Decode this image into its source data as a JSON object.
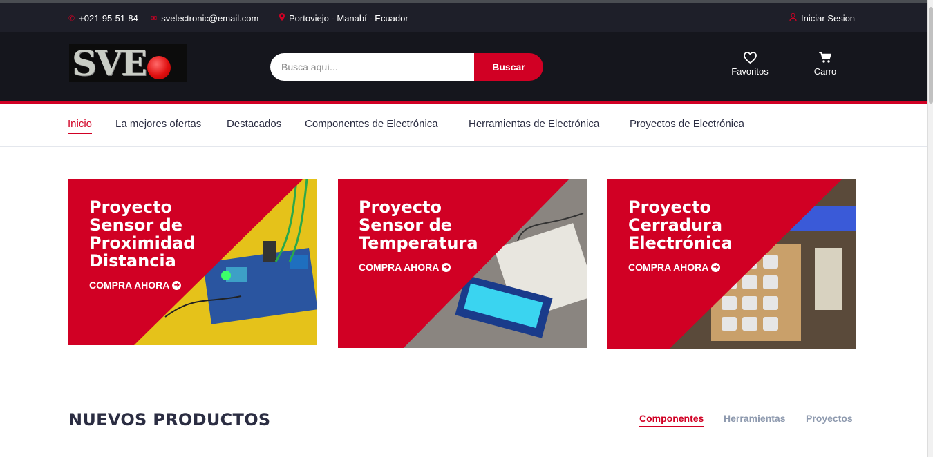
{
  "topbar": {
    "phone": "+021-95-51-84",
    "email": "svelectronic@email.com",
    "location": "Portoviejo - Manabí - Ecuador",
    "login": "Iniciar Sesion"
  },
  "header": {
    "logo_text": "SVE",
    "search_placeholder": "Busca aquí...",
    "search_button": "Buscar",
    "favorites_label": "Favoritos",
    "cart_label": "Carro"
  },
  "nav": {
    "items": [
      {
        "label": "Inicio",
        "active": true
      },
      {
        "label": "La mejores ofertas"
      },
      {
        "label": "Destacados"
      },
      {
        "label": "Componentes de Electrónica"
      },
      {
        "label": "Herramientas de Electrónica"
      },
      {
        "label": "Proyectos de Electrónica"
      }
    ]
  },
  "promos": [
    {
      "title_lines": [
        "Proyecto",
        "Sensor de",
        "Proximidad",
        "Distancia"
      ],
      "cta": "COMPRA AHORA"
    },
    {
      "title_lines": [
        "Proyecto",
        "Sensor de",
        "Temperatura"
      ],
      "cta": "COMPRA AHORA"
    },
    {
      "title_lines": [
        "Proyecto",
        "Cerradura",
        "Electrónica"
      ],
      "cta": "COMPRA AHORA"
    }
  ],
  "section": {
    "title": "NUEVOS PRODUCTOS",
    "tabs": [
      {
        "label": "Componentes",
        "active": true
      },
      {
        "label": "Herramientas"
      },
      {
        "label": "Proyectos"
      }
    ]
  },
  "colors": {
    "accent": "#d10024",
    "dark": "#15161d",
    "topbar": "#1e1f29"
  }
}
